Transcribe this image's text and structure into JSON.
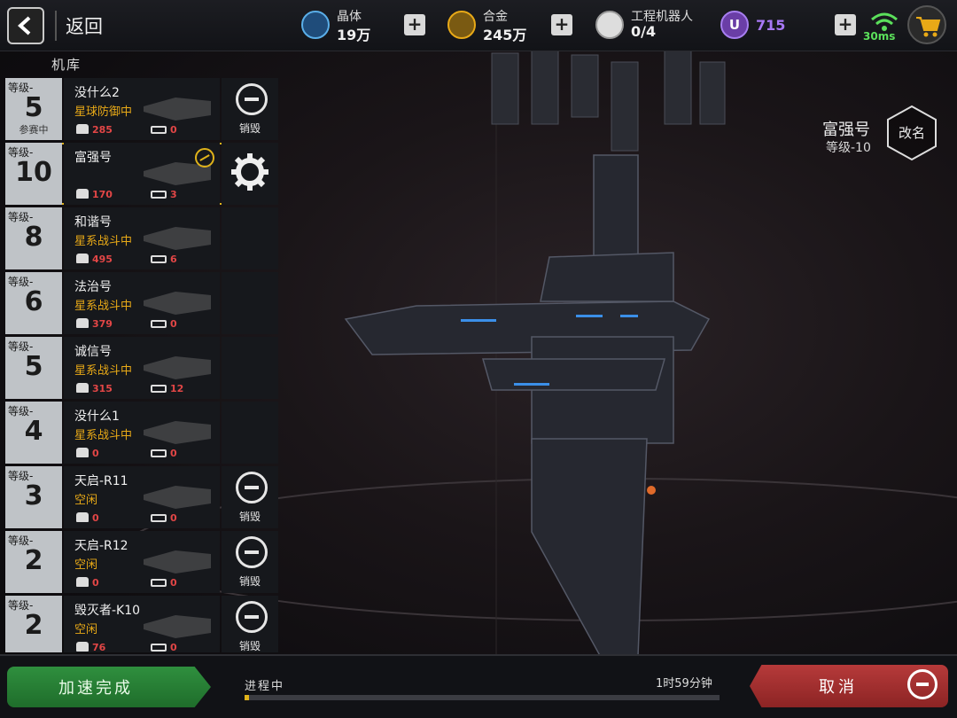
{
  "header": {
    "back_label": "返回",
    "resources": [
      {
        "name": "晶体",
        "value": "19万",
        "icon": "crystal-icon",
        "color": "#5aaee8"
      },
      {
        "name": "合金",
        "value": "245万",
        "icon": "alloy-icon",
        "color": "#e8a917"
      },
      {
        "name": "工程机器人",
        "value": "0/4",
        "icon": "robot-icon",
        "color": "#e6e6e6"
      }
    ],
    "premium": {
      "label": "U",
      "value": "715",
      "color": "#a878f5"
    },
    "ping": "30ms"
  },
  "hangar": {
    "title": "机库",
    "ships": [
      {
        "level_label": "等级-",
        "level": "5",
        "tag": "参赛中",
        "name": "没什么2",
        "status": "星球防御中",
        "crew": "285",
        "guns": "0",
        "action": "销毁"
      },
      {
        "level_label": "等级-",
        "level": "10",
        "tag": "",
        "name": "富强号",
        "status": "",
        "crew": "170",
        "guns": "3",
        "action": "",
        "selected": true
      },
      {
        "level_label": "等级-",
        "level": "8",
        "tag": "",
        "name": "和谐号",
        "status": "星系战斗中",
        "crew": "495",
        "guns": "6",
        "action": ""
      },
      {
        "level_label": "等级-",
        "level": "6",
        "tag": "",
        "name": "法治号",
        "status": "星系战斗中",
        "crew": "379",
        "guns": "0",
        "action": ""
      },
      {
        "level_label": "等级-",
        "level": "5",
        "tag": "",
        "name": "诚信号",
        "status": "星系战斗中",
        "crew": "315",
        "guns": "12",
        "action": ""
      },
      {
        "level_label": "等级-",
        "level": "4",
        "tag": "",
        "name": "没什么1",
        "status": "星系战斗中",
        "crew": "0",
        "guns": "0",
        "action": ""
      },
      {
        "level_label": "等级-",
        "level": "3",
        "tag": "",
        "name": "天启-R11",
        "status": "空闲",
        "crew": "0",
        "guns": "0",
        "action": "销毁"
      },
      {
        "level_label": "等级-",
        "level": "2",
        "tag": "",
        "name": "天启-R12",
        "status": "空闲",
        "crew": "0",
        "guns": "0",
        "action": "销毁"
      },
      {
        "level_label": "等级-",
        "level": "2",
        "tag": "",
        "name": "毁灭者-K10",
        "status": "空闲",
        "crew": "76",
        "guns": "0",
        "action": "销毁"
      }
    ]
  },
  "selected_ship": {
    "name": "富强号",
    "level": "等级-10",
    "rename_label": "改名"
  },
  "footer": {
    "speedup_label": "加速完成",
    "progress_label": "进程中",
    "progress_time": "1时59分钟",
    "progress": 0.01,
    "cancel_label": "取消"
  },
  "colors": {
    "accent": "#e0b31a",
    "status": "#e8a917",
    "danger": "#e24646",
    "confirm": "#2f8f3e",
    "cancel": "#b63a3a"
  }
}
